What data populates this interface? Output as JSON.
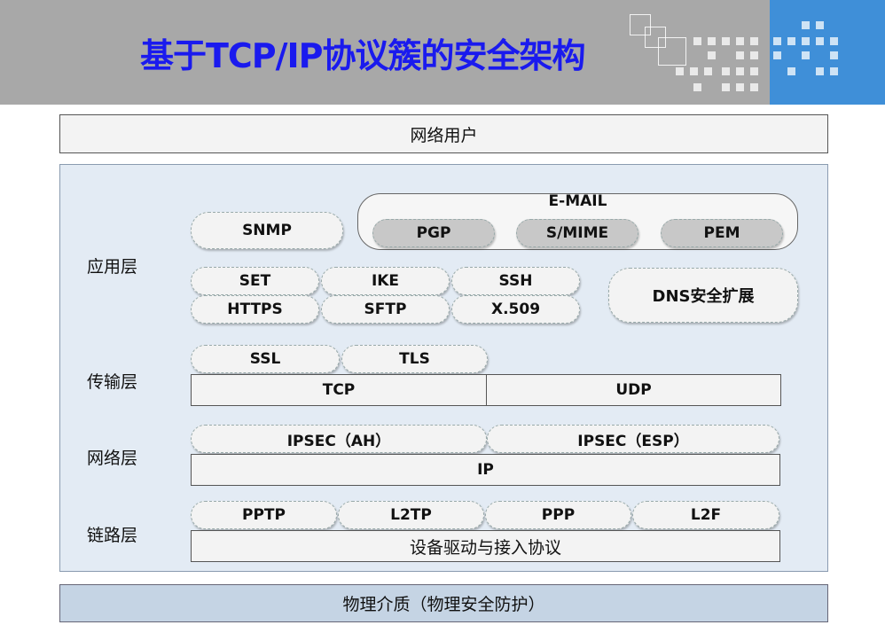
{
  "title": "基于TCP/IP协议簇的安全架构",
  "top_bar": "网络用户",
  "bottom_bar": "物理介质（物理安全防护）",
  "layers": {
    "application": "应用层",
    "transport": "传输层",
    "network": "网络层",
    "link": "链路层"
  },
  "application": {
    "snmp": "SNMP",
    "email_title": "E-MAIL",
    "email_items": [
      "PGP",
      "S/MIME",
      "PEM"
    ],
    "row1": [
      "SET",
      "IKE",
      "SSH"
    ],
    "row2": [
      "HTTPS",
      "SFTP",
      "X.509"
    ],
    "dns": "DNS安全扩展"
  },
  "transport": {
    "security": [
      "SSL",
      "TLS"
    ],
    "protocols": [
      "TCP",
      "UDP"
    ]
  },
  "network": {
    "security": [
      "IPSEC（AH）",
      "IPSEC（ESP）"
    ],
    "protocol": "IP"
  },
  "link": {
    "security": [
      "PPTP",
      "L2TP",
      "PPP",
      "L2F"
    ],
    "protocol": "设备驱动与接入协议"
  }
}
